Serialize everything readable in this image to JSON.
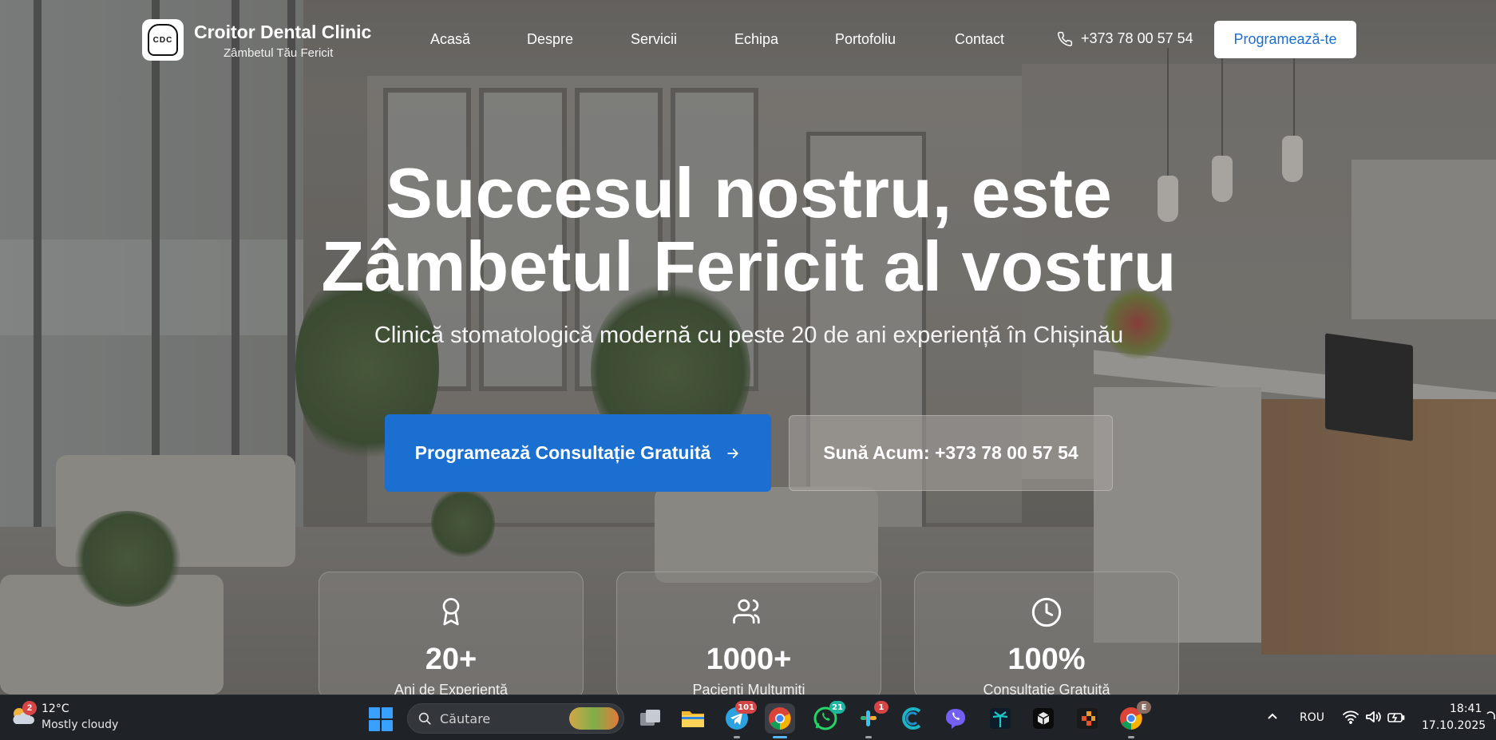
{
  "header": {
    "logo_text": "CDC",
    "brand_name": "Croitor Dental Clinic",
    "brand_tagline": "Zâmbetul Tău Fericit",
    "nav": [
      "Acasă",
      "Despre",
      "Servicii",
      "Echipa",
      "Portofoliu",
      "Contact"
    ],
    "phone": "+373 78 00 57 54",
    "cta_label": "Programează-te"
  },
  "hero": {
    "headline_line1": "Succesul nostru, este",
    "headline_line2": "Zâmbetul Fericit al vostru",
    "subline": "Clinică stomatologică modernă cu peste 20 de ani experiență în Chișinău",
    "primary_button": "Programează Consultație Gratuită",
    "primary_button_icon": "arrow-right-icon",
    "secondary_button": "Sună Acum: +373 78 00 57 54"
  },
  "stats": [
    {
      "icon": "award-icon",
      "value": "20+",
      "label": "Ani de Experiență"
    },
    {
      "icon": "users-icon",
      "value": "1000+",
      "label": "Pacienți Mulțumiți"
    },
    {
      "icon": "clock-icon",
      "value": "100%",
      "label": "Consultație Gratuită"
    }
  ],
  "taskbar": {
    "weather_badge": "2",
    "weather_temp": "12°C",
    "weather_desc": "Mostly cloudy",
    "search_placeholder": "Căutare",
    "apps": [
      {
        "name": "task-view-icon"
      },
      {
        "name": "file-explorer-icon"
      },
      {
        "name": "telegram-icon",
        "badge": "101"
      },
      {
        "name": "chrome-icon",
        "active": true
      },
      {
        "name": "whatsapp-icon",
        "badge": "21"
      },
      {
        "name": "slack-icon",
        "badge": "1"
      },
      {
        "name": "app-wave-icon"
      },
      {
        "name": "viber-icon"
      },
      {
        "name": "app-palm-icon"
      },
      {
        "name": "app-cube-icon"
      },
      {
        "name": "app-blocks-icon"
      },
      {
        "name": "chrome-profile-icon",
        "badge": "E"
      }
    ],
    "language": "ROU",
    "time": "18:41",
    "date": "17.10.2025"
  },
  "colors": {
    "accent_blue": "#1a6fd0",
    "taskbar_bg": "#1f2226",
    "badge_red": "#d64545",
    "badge_teal": "#25d366"
  }
}
